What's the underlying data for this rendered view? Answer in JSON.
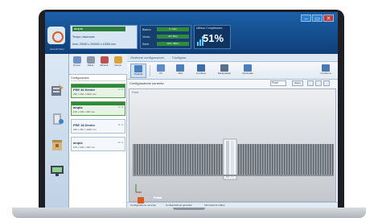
{
  "window": {
    "controls": [
      "–",
      "▭",
      "✕"
    ]
  },
  "header": {
    "logo_caption": "Ground Floor",
    "info": {
      "name": "ampia",
      "line1": "Tempo: bianconel",
      "line2": "Imm: 20000 x 200000 x 10000 mm"
    },
    "stats": [
      {
        "label": "Bianco",
        "value": "6 / 30m"
      },
      {
        "label": "Vicino",
        "value": "30 / 60m"
      },
      {
        "label": "Serie",
        "value": "160 / 450m"
      }
    ],
    "percent": {
      "title": "Utilizzo Complessivo",
      "value": "51%"
    }
  },
  "toolbar": {
    "items": [
      {
        "label": "Nuova"
      },
      {
        "label": "Salva"
      },
      {
        "label": "Elimina"
      },
      {
        "label": "Cerca"
      }
    ]
  },
  "list": {
    "header": "Configurazioni",
    "items": [
      {
        "title": "FRE 36 Dexter",
        "desc": "250 x 250 x 2000 mm",
        "count": "1 / 1",
        "selected": true
      },
      {
        "title": "ampia",
        "desc": "100 x 200 x 400 mm",
        "count": "1 / 1",
        "selected": true
      },
      {
        "title": "FRE 18 Dexter",
        "desc": "250 x 250 x 2000 mm",
        "count": "0 / 1",
        "selected": false
      },
      {
        "title": "ampia",
        "desc": "100 x 200 x 400 mm",
        "count": "0 / 1",
        "selected": false
      }
    ]
  },
  "tabs": [
    "Gestione configurazioni",
    "Configura"
  ],
  "ribbon": {
    "buttons": [
      {
        "label": "Prodotti",
        "active": true
      },
      {
        "label": "Kit",
        "active": false
      },
      {
        "label": "Add",
        "active": false
      },
      {
        "label": "Corridoio",
        "active": false
      },
      {
        "label": "Manipolatori",
        "active": false
      },
      {
        "label": "Opzionale",
        "active": false
      }
    ],
    "right_button": "Conferma"
  },
  "config": {
    "label": "Configurazione corrente",
    "zoom_value": "Front",
    "zoom_button": "Zoom"
  },
  "viewport": {
    "tag": "Front"
  },
  "bottom_tabs": [
    "Configurazione corrente",
    "Configurazione generale",
    "Informazioni ordine"
  ],
  "brand": {
    "line1": "Prima",
    "line2": "Power"
  }
}
